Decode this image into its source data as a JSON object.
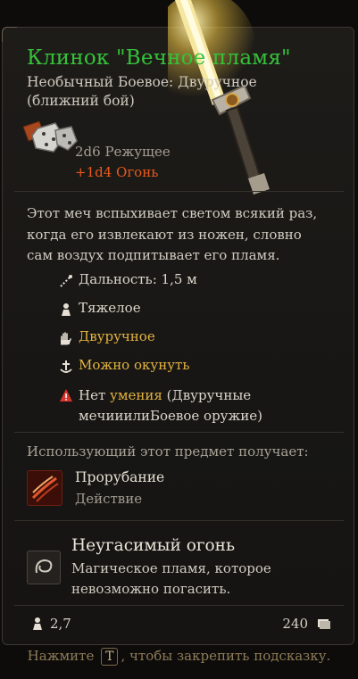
{
  "item": {
    "name": "Клинок \"Вечное пламя\"",
    "category": "Необычный Боевое: Двуручное (ближний бой)",
    "damage_primary": "2d6 Режущее",
    "damage_bonus": "+1d4 Огонь",
    "description": "Этот меч вспыхивает светом всякий раз, когда его извлекают из ножен, словно сам воздух подпитывает его пламя."
  },
  "properties": {
    "range": "Дальность: 1,5 м",
    "heavy": "Тяжелое",
    "two_handed": "Двуручное",
    "dippable": "Можно окунуть",
    "proficiency_prefix": "Нет",
    "proficiency_word": "умения",
    "proficiency_rest": "(Двуручные мечииилиБоевое оружие)"
  },
  "grants": {
    "header": "Использующий этот предмет получает:",
    "action_name": "Прорубание",
    "action_type": "Действие",
    "passive_name": "Неугасимый огонь",
    "passive_desc": "Магическое пламя, которое невозможно погасить."
  },
  "footer": {
    "weight": "2,7",
    "price": "240",
    "hint_before": "Нажмите",
    "hint_key": "T",
    "hint_after": ", чтобы закрепить подсказку."
  },
  "colors": {
    "title": "#35c23a",
    "fire": "#e85a1c",
    "highlight": "#e3b341",
    "warning": "#d8332a"
  },
  "icons": [
    "dice-icon",
    "range-icon",
    "heavy-icon",
    "two-handed-icon",
    "dip-icon",
    "warning-icon",
    "slash-action-icon",
    "fire-passive-icon",
    "weight-icon",
    "coin-icon"
  ]
}
